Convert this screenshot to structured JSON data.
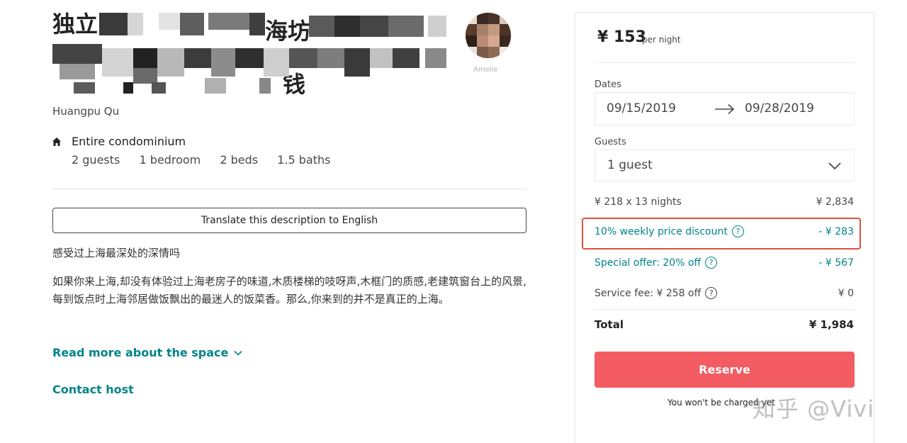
{
  "listing": {
    "title_visible_start": "独立",
    "title_visible_mid": "海坊",
    "title_visible_end": "钱",
    "location": "Huangpu Qu",
    "property_type": "Entire condominium",
    "stats": [
      "2 guests",
      "1 bedroom",
      "2 beds",
      "1.5 baths"
    ],
    "host_name": "Amelie"
  },
  "description": {
    "translate_label": "Translate this description to English",
    "heading": "感受过上海最深处的深情吗",
    "body": "如果你来上海,却没有体验过上海老房子的味道,木质楼梯的吱呀声,木框门的质感,老建筑窗台上的风景,每到饭点时上海邻居做饭飘出的最迷人的饭菜香。那么,你来到的并不是真正的上海。",
    "read_more_label": "Read more about the space",
    "contact_host_label": "Contact host"
  },
  "booking": {
    "price": "¥ 153",
    "price_unit": "per night",
    "dates_label": "Dates",
    "check_in": "09/15/2019",
    "check_out": "09/28/2019",
    "guests_label": "Guests",
    "guests_value": "1 guest",
    "lines": [
      {
        "label": "¥ 218 x 13 nights",
        "value": "¥ 2,834"
      },
      {
        "label": "10% weekly price discount",
        "value": "- ¥ 283"
      },
      {
        "label": "Special offer: 20% off",
        "value": "- ¥ 567"
      },
      {
        "label": "Service fee: ¥ 258 off",
        "value": "¥ 0"
      }
    ],
    "total_label": "Total",
    "total_value": "¥ 1,984",
    "reserve_label": "Reserve",
    "charge_note": "You won't be charged yet"
  },
  "watermark": "知乎 @Vivi",
  "colors": {
    "accent_teal": "#008489",
    "reserve_red": "#f35c63",
    "highlight_outline": "#e0523a"
  },
  "icons": [
    "home-icon",
    "arrow-right-icon",
    "chevron-down-icon",
    "question-circle-icon"
  ]
}
